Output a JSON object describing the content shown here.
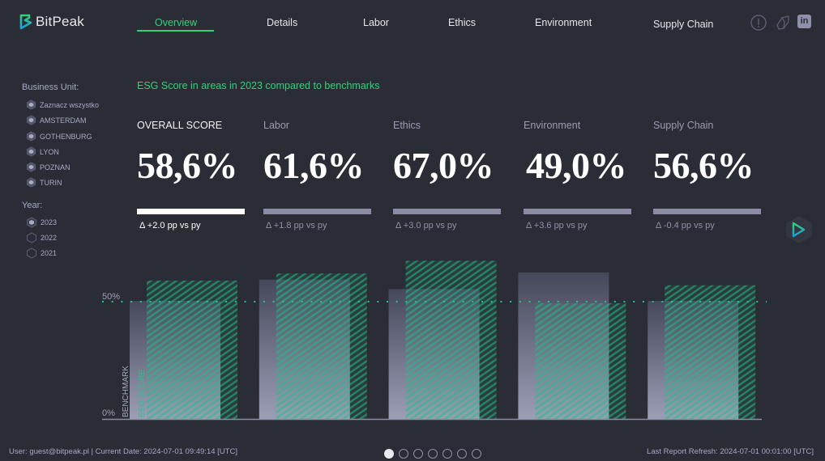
{
  "app": {
    "logo_text": "BitPeak"
  },
  "nav": {
    "items": [
      {
        "label": "Overview",
        "active": true
      },
      {
        "label": "Details"
      },
      {
        "label": "Labor"
      },
      {
        "label": "Ethics"
      },
      {
        "label": "Environment"
      },
      {
        "label": "Supply Chain"
      }
    ],
    "icons": [
      "info-icon",
      "tag-icon",
      "linkedin-icon"
    ],
    "linkedin_text": "in"
  },
  "sidebar": {
    "business_unit_title": "Business Unit:",
    "business_units": [
      {
        "label": "Zaznacz wszystko",
        "selected": true
      },
      {
        "label": "AMSTERDAM",
        "selected": true
      },
      {
        "label": "GOTHENBURG",
        "selected": true
      },
      {
        "label": "LYON",
        "selected": true
      },
      {
        "label": "POZNAN",
        "selected": true
      },
      {
        "label": "TURIN",
        "selected": true
      }
    ],
    "year_title": "Year:",
    "years": [
      {
        "label": "2023",
        "selected": true
      },
      {
        "label": "2022",
        "selected": false
      },
      {
        "label": "2021",
        "selected": false
      }
    ]
  },
  "main": {
    "subtitle": "ESG Score in areas in 2023 compared to benchmarks",
    "cards": [
      {
        "label": "OVERALL SCORE",
        "value": "58,6%",
        "delta": "Δ +2.0 pp vs py",
        "active": true
      },
      {
        "label": "Labor",
        "value": "61,6%",
        "delta": "Δ +1.8 pp vs py"
      },
      {
        "label": "Ethics",
        "value": "67,0%",
        "delta": "Δ +3.0 pp vs py"
      },
      {
        "label": "Environment",
        "value": "49,0%",
        "delta": "Δ +3.6 pp vs py"
      },
      {
        "label": "Supply Chain",
        "value": "56,6%",
        "delta": "Δ -0.4 pp vs py"
      }
    ],
    "play_icon": "play-icon"
  },
  "chart_data": {
    "type": "bar",
    "categories": [
      "Overall",
      "Labor",
      "Ethics",
      "Environment",
      "Supply Chain"
    ],
    "series": [
      {
        "name": "BENCHMARK",
        "values": [
          50,
          59,
          55,
          62,
          50
        ],
        "color": "#9a9cb4"
      },
      {
        "name": "ESG SCORE",
        "values": [
          58.6,
          61.6,
          67.0,
          49.0,
          56.6
        ],
        "color": "#22c58b"
      }
    ],
    "reference_line": {
      "value": 50,
      "style": "dotted",
      "color": "#22c58b"
    },
    "ytick_labels": [
      "0%",
      "50%"
    ],
    "yticks": [
      0,
      50
    ],
    "ylim": [
      0,
      70
    ],
    "grid": false,
    "legend": "rotated labels inside first group"
  },
  "footer": {
    "user_info": "User: guest@bitpeak.pl | Current Date: 2024-07-01 09:49:14 [UTC]",
    "refresh_info": "Last Report Refresh: 2024-07-01 00:01:00 [UTC]",
    "pages": 7,
    "current_page": 1
  }
}
